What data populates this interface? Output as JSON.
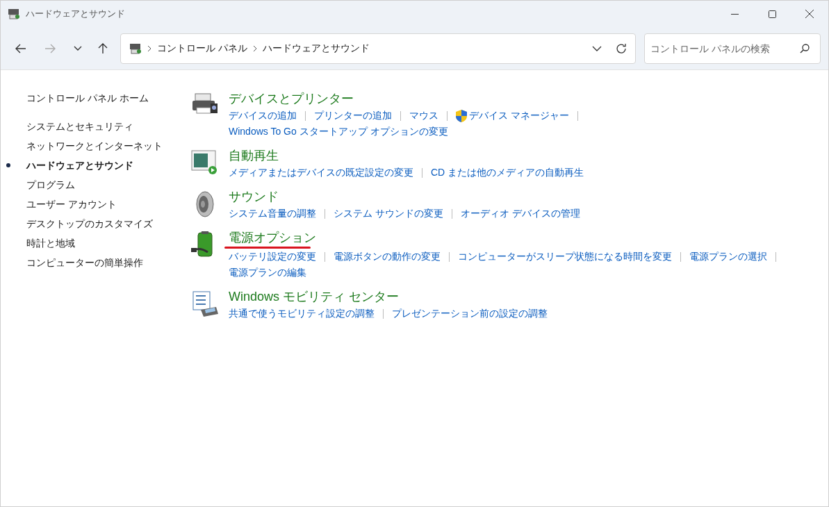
{
  "window": {
    "title": "ハードウェアとサウンド"
  },
  "nav": {
    "back_disabled": false,
    "forward_disabled": true
  },
  "address": {
    "crumbs": [
      "コントロール パネル",
      "ハードウェアとサウンド"
    ]
  },
  "search": {
    "placeholder": "コントロール パネルの検索"
  },
  "sidebar": {
    "home": "コントロール パネル ホーム",
    "items": [
      {
        "label": "システムとセキュリティ",
        "selected": false
      },
      {
        "label": "ネットワークとインターネット",
        "selected": false
      },
      {
        "label": "ハードウェアとサウンド",
        "selected": true
      },
      {
        "label": "プログラム",
        "selected": false
      },
      {
        "label": "ユーザー アカウント",
        "selected": false
      },
      {
        "label": "デスクトップのカスタマイズ",
        "selected": false
      },
      {
        "label": "時計と地域",
        "selected": false
      },
      {
        "label": "コンピューターの簡単操作",
        "selected": false
      }
    ]
  },
  "categories": [
    {
      "kind": "printer",
      "title": "デバイスとプリンター",
      "highlighted": false,
      "rows": [
        [
          {
            "label": "デバイスの追加",
            "shield": false
          },
          {
            "label": "プリンターの追加",
            "shield": false
          },
          {
            "label": "マウス",
            "shield": false
          },
          {
            "label": "デバイス マネージャー",
            "shield": true
          }
        ],
        [
          {
            "label": "Windows To Go スタートアップ オプションの変更",
            "shield": false
          }
        ]
      ]
    },
    {
      "kind": "autoplay",
      "title": "自動再生",
      "highlighted": false,
      "rows": [
        [
          {
            "label": "メディアまたはデバイスの既定設定の変更",
            "shield": false
          },
          {
            "label": "CD または他のメディアの自動再生",
            "shield": false
          }
        ]
      ]
    },
    {
      "kind": "sound",
      "title": "サウンド",
      "highlighted": false,
      "rows": [
        [
          {
            "label": "システム音量の調整",
            "shield": false
          },
          {
            "label": "システム サウンドの変更",
            "shield": false
          },
          {
            "label": "オーディオ デバイスの管理",
            "shield": false
          }
        ]
      ]
    },
    {
      "kind": "power",
      "title": "電源オプション",
      "highlighted": true,
      "rows": [
        [
          {
            "label": "バッテリ設定の変更",
            "shield": false
          },
          {
            "label": "電源ボタンの動作の変更",
            "shield": false
          },
          {
            "label": "コンピューターがスリープ状態になる時間を変更",
            "shield": false
          },
          {
            "label": "電源プランの選択",
            "shield": false
          }
        ],
        [
          {
            "label": "電源プランの編集",
            "shield": false
          }
        ]
      ]
    },
    {
      "kind": "mobility",
      "title": "Windows モビリティ センター",
      "highlighted": false,
      "rows": [
        [
          {
            "label": "共通で使うモビリティ設定の調整",
            "shield": false
          },
          {
            "label": "プレゼンテーション前の設定の調整",
            "shield": false
          }
        ]
      ]
    }
  ]
}
